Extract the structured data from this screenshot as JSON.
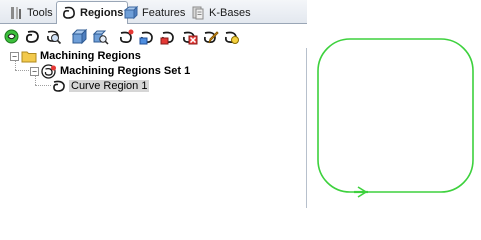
{
  "tabs": [
    {
      "label": "Tools",
      "icon": "tools-icon",
      "active": false
    },
    {
      "label": "Regions",
      "icon": "regions-icon",
      "active": true
    },
    {
      "label": "Features",
      "icon": "features-icon",
      "active": false
    },
    {
      "label": "K-Bases",
      "icon": "kbases-icon",
      "active": false
    }
  ],
  "toolbar": {
    "buttons": [
      "new-region-set-icon",
      "curve-region-icon",
      "region-view-icon",
      "create-feature-icon",
      "feature-view-icon",
      "pick-region-icon",
      "draw-region-icon",
      "edit-region-icon",
      "delete-region-icon",
      "rename-region-icon",
      "region-properties-icon",
      "region-settings-icon"
    ]
  },
  "tree": {
    "root": {
      "label": "Machining Regions",
      "expander": "−"
    },
    "set": {
      "label": "Machining Regions Set 1",
      "expander": "−"
    },
    "item": {
      "label": "Curve Region 1"
    }
  },
  "colors": {
    "curve": "#3dd13d",
    "folder": "#f2c94c",
    "accent": "#1e6fc9"
  }
}
